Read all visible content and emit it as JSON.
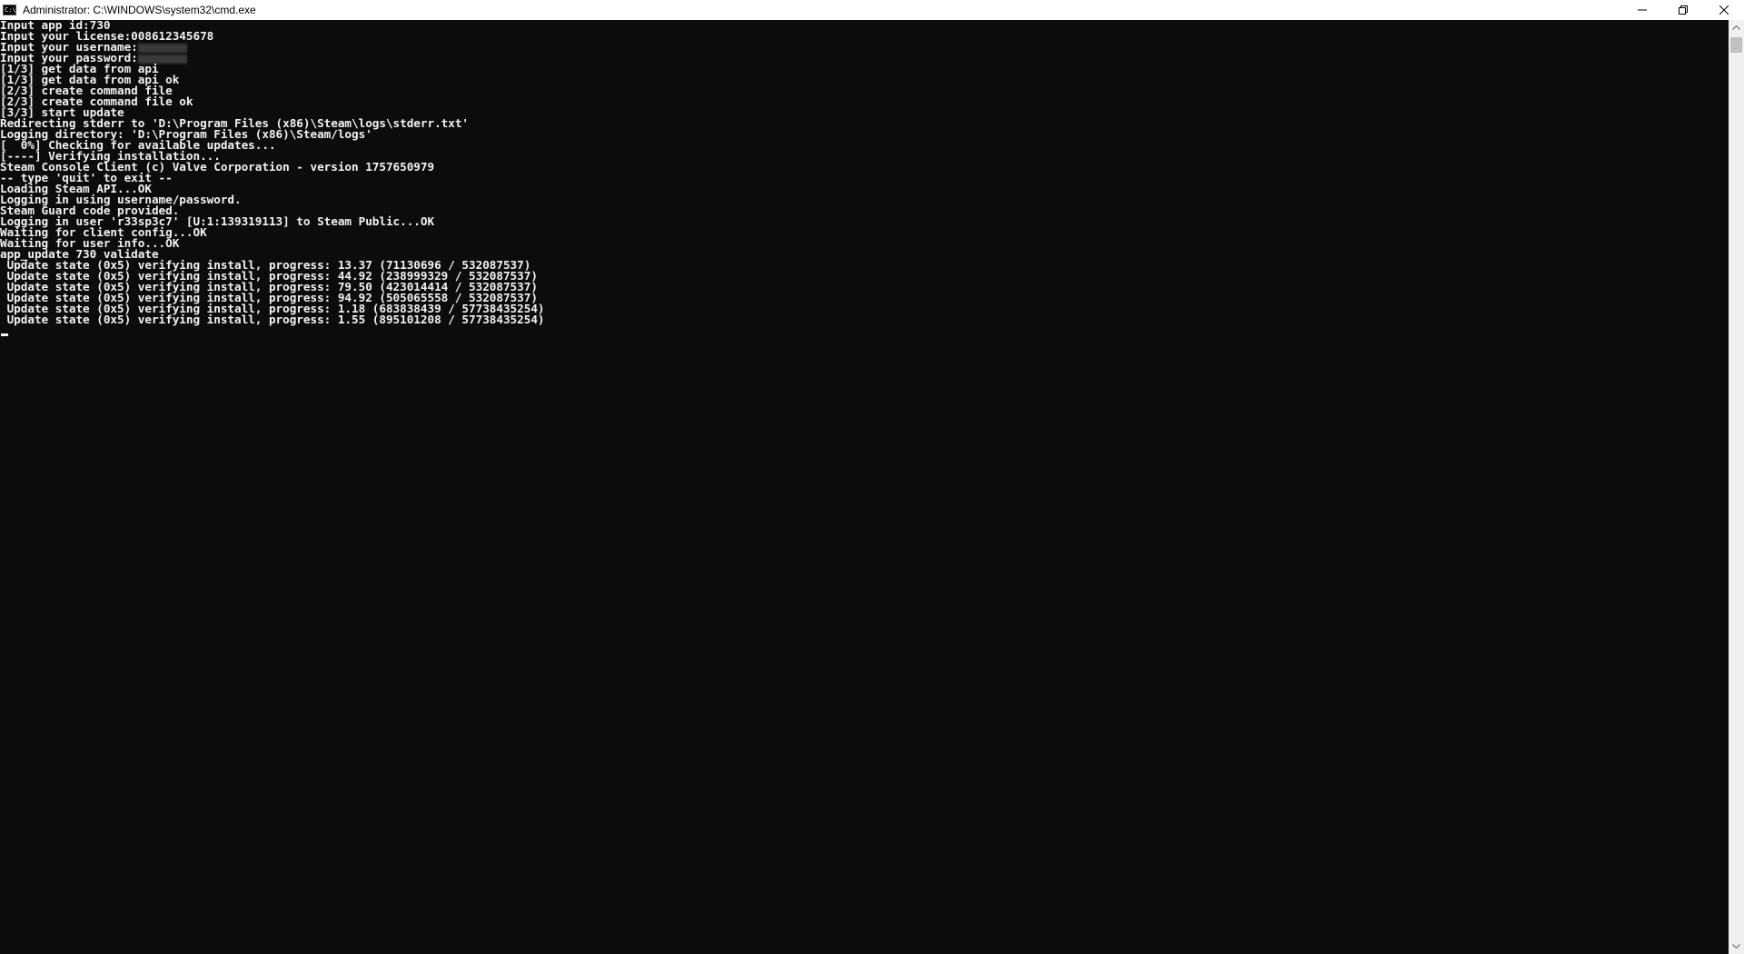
{
  "window": {
    "title": "Administrator: C:\\WINDOWS\\system32\\cmd.exe",
    "icon": "cmd-icon",
    "controls": [
      "minimize-icon",
      "restore-icon",
      "close-icon"
    ]
  },
  "console": {
    "lines": [
      {
        "text": "Input app id:730"
      },
      {
        "text": "Input your license:008612345678"
      },
      {
        "text": "Input your username:",
        "masked": true
      },
      {
        "text": "Input your password:",
        "masked": true
      },
      {
        "text": "[1/3] get data from api"
      },
      {
        "text": "[1/3] get data from api ok"
      },
      {
        "text": "[2/3] create command file"
      },
      {
        "text": "[2/3] create command file ok"
      },
      {
        "text": "[3/3] start update"
      },
      {
        "text": "Redirecting stderr to 'D:\\Program Files (x86)\\Steam\\logs\\stderr.txt'"
      },
      {
        "text": "Logging directory: 'D:\\Program Files (x86)\\Steam/logs'"
      },
      {
        "text": "[  0%] Checking for available updates..."
      },
      {
        "text": "[----] Verifying installation..."
      },
      {
        "text": "Steam Console Client (c) Valve Corporation - version 1757650979"
      },
      {
        "text": "-- type 'quit' to exit --"
      },
      {
        "text": "Loading Steam API...OK"
      },
      {
        "text": "Logging in using username/password."
      },
      {
        "text": "Steam Guard code provided."
      },
      {
        "text": "Logging in user 'r33sp3c7' [U:1:139319113] to Steam Public...OK"
      },
      {
        "text": "Waiting for client config...OK"
      },
      {
        "text": "Waiting for user info...OK"
      },
      {
        "text": "app_update 730 validate"
      },
      {
        "text": " Update state (0x5) verifying install, progress: 13.37 (71130696 / 532087537)"
      },
      {
        "text": " Update state (0x5) verifying install, progress: 44.92 (238999329 / 532087537)"
      },
      {
        "text": " Update state (0x5) verifying install, progress: 79.50 (423014414 / 532087537)"
      },
      {
        "text": " Update state (0x5) verifying install, progress: 94.92 (505065558 / 532087537)"
      },
      {
        "text": " Update state (0x5) verifying install, progress: 1.18 (683838439 / 57738435254)"
      },
      {
        "text": " Update state (0x5) verifying install, progress: 1.55 (895101208 / 57738435254)"
      }
    ]
  },
  "scrollbar": {
    "up_icon": "scroll-up-arrow-icon",
    "down_icon": "scroll-down-arrow-icon"
  }
}
